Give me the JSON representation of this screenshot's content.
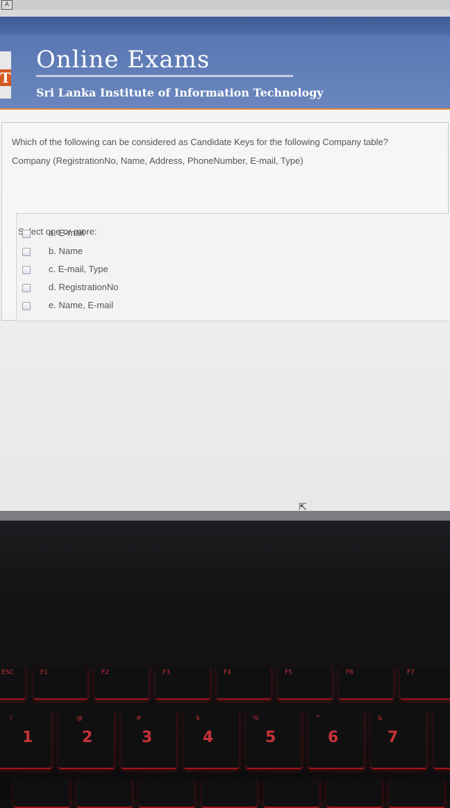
{
  "browser": {
    "icon": "page-icon"
  },
  "header": {
    "title": "Online Exams",
    "subtitle": "Sri Lanka Institute of Information Technology",
    "logo_letter": "T"
  },
  "question": {
    "text": "Which of the following can be considered as Candidate Keys for the following Company table?",
    "schema": "Company (RegistrationNo, Name, Address, PhoneNumber, E-mail, Type)",
    "prompt": "Select one or more:",
    "options": [
      {
        "label": "a. E-mail",
        "checked": false
      },
      {
        "label": "b. Name",
        "checked": false
      },
      {
        "label": "c. E-mail, Type",
        "checked": false
      },
      {
        "label": "d. RegistrationNo",
        "checked": false
      },
      {
        "label": "e. Name, E-mail",
        "checked": false
      }
    ]
  },
  "keyboard": {
    "fn_row": [
      "ESC",
      "F1",
      "F2",
      "F3",
      "F4",
      "F5",
      "F6",
      "F7"
    ],
    "num_row": [
      "1",
      "2",
      "3",
      "4",
      "5",
      "6",
      "7"
    ],
    "shift_row": [
      "!",
      "@",
      "#",
      "$",
      "%",
      "^",
      "&"
    ],
    "accent": "#c83238"
  }
}
